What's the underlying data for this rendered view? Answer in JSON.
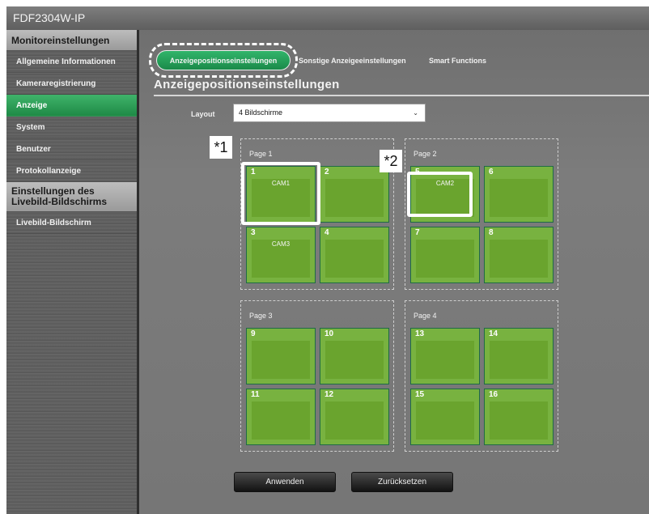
{
  "app": {
    "title": "FDF2304W-IP"
  },
  "sidebar": {
    "section1": "Monitoreinstellungen",
    "items": [
      {
        "label": "Allgemeine Informationen",
        "active": false
      },
      {
        "label": "Kameraregistrierung",
        "active": false
      },
      {
        "label": "Anzeige",
        "active": true
      },
      {
        "label": "System",
        "active": false
      },
      {
        "label": "Benutzer",
        "active": false
      },
      {
        "label": "Protokollanzeige",
        "active": false
      }
    ],
    "section2": "Einstellungen des Livebild-Bildschirms",
    "items2": [
      {
        "label": "Livebild-Bildschirm",
        "active": false
      }
    ]
  },
  "tabs": [
    {
      "label": "Anzeigepositionseinstellungen",
      "active": true
    },
    {
      "label": "Sonstige Anzeigeeinstellungen",
      "active": false
    },
    {
      "label": "Smart Functions",
      "active": false
    }
  ],
  "main": {
    "title": "Anzeigepositionseinstellungen",
    "layout_label": "Layout",
    "layout_value": "4 Bildschirme"
  },
  "pages": [
    {
      "label": "Page 1",
      "cells": [
        {
          "num": "1",
          "cam": "CAM1"
        },
        {
          "num": "2",
          "cam": ""
        },
        {
          "num": "3",
          "cam": "CAM3"
        },
        {
          "num": "4",
          "cam": ""
        }
      ]
    },
    {
      "label": "Page 2",
      "cells": [
        {
          "num": "5",
          "cam": "CAM2"
        },
        {
          "num": "6",
          "cam": ""
        },
        {
          "num": "7",
          "cam": ""
        },
        {
          "num": "8",
          "cam": ""
        }
      ]
    },
    {
      "label": "Page 3",
      "cells": [
        {
          "num": "9",
          "cam": ""
        },
        {
          "num": "10",
          "cam": ""
        },
        {
          "num": "11",
          "cam": ""
        },
        {
          "num": "12",
          "cam": ""
        }
      ]
    },
    {
      "label": "Page 4",
      "cells": [
        {
          "num": "13",
          "cam": ""
        },
        {
          "num": "14",
          "cam": ""
        },
        {
          "num": "15",
          "cam": ""
        },
        {
          "num": "16",
          "cam": ""
        }
      ]
    }
  ],
  "annotations": {
    "note1": "*1",
    "note2": "*2"
  },
  "buttons": {
    "apply": "Anwenden",
    "reset": "Zurücksetzen"
  },
  "colors": {
    "accent": "#2aa45c",
    "cell": "#78b240",
    "cell_border": "#1f6b46"
  }
}
